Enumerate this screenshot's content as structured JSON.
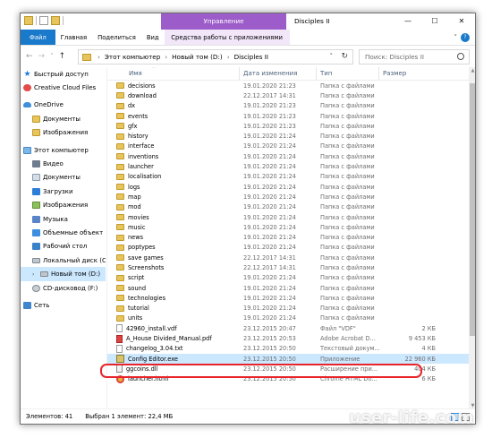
{
  "titlebar": {
    "context_tab": "Управление",
    "title": "Disciples II",
    "minimize": "—",
    "maximize": "☐",
    "close": "✕"
  },
  "ribbon": {
    "tabs": [
      "Файл",
      "Главная",
      "Поделиться",
      "Вид"
    ],
    "context_tab": "Средства работы с приложениями",
    "expand": "˅",
    "help": "?"
  },
  "addressbar": {
    "back": "←",
    "forward": "→",
    "recent": "˅",
    "up": "↑",
    "crumbs": [
      "Этот компьютер",
      "Новый том (D:)",
      "Disciples II"
    ],
    "separator": "›",
    "dropdown": "˅",
    "refresh": "↻",
    "search_placeholder": "Поиск: Disciples II"
  },
  "nav_pane": {
    "items": [
      {
        "label": "Быстрый доступ",
        "icon": "star-icon",
        "level": 0
      },
      {
        "label": "Creative Cloud Files",
        "icon": "creative-cloud-icon",
        "level": 0
      },
      {
        "label": "OneDrive",
        "icon": "onedrive-icon",
        "level": 0
      },
      {
        "label": "Документы",
        "icon": "folder-icon",
        "level": 1
      },
      {
        "label": "Изображения",
        "icon": "folder-icon",
        "level": 1
      },
      {
        "label": "Этот компьютер",
        "icon": "computer-icon",
        "level": 0
      },
      {
        "label": "Видео",
        "icon": "video-icon",
        "level": 1
      },
      {
        "label": "Документы",
        "icon": "documents-icon",
        "level": 1
      },
      {
        "label": "Загрузки",
        "icon": "downloads-icon",
        "level": 1
      },
      {
        "label": "Изображения",
        "icon": "pictures-icon",
        "level": 1
      },
      {
        "label": "Музыка",
        "icon": "music-icon",
        "level": 1
      },
      {
        "label": "Объемные объект",
        "icon": "3d-objects-icon",
        "level": 1
      },
      {
        "label": "Рабочий стол",
        "icon": "desktop-icon",
        "level": 1
      },
      {
        "label": "Локальный диск (C",
        "icon": "drive-icon",
        "level": 1
      },
      {
        "label": "Новый том (D:)",
        "icon": "drive-icon",
        "level": 1,
        "selected": true
      },
      {
        "label": "CD-дисковод (F:)",
        "icon": "cd-drive-icon",
        "level": 1
      },
      {
        "label": "Сеть",
        "icon": "network-icon",
        "level": 0
      }
    ]
  },
  "columns": {
    "name": "Имя",
    "date": "Дата изменения",
    "type": "Тип",
    "size": "Размер",
    "sort_caret": "^"
  },
  "files": [
    {
      "name": "decisions",
      "date": "19.01.2020 21:23",
      "type": "Папка с файлами",
      "size": "",
      "icon": "folder"
    },
    {
      "name": "download",
      "date": "22.12.2017 14:31",
      "type": "Папка с файлами",
      "size": "",
      "icon": "folder"
    },
    {
      "name": "dx",
      "date": "19.01.2020 21:23",
      "type": "Папка с файлами",
      "size": "",
      "icon": "folder"
    },
    {
      "name": "events",
      "date": "19.01.2020 21:23",
      "type": "Папка с файлами",
      "size": "",
      "icon": "folder"
    },
    {
      "name": "gfx",
      "date": "19.01.2020 21:23",
      "type": "Папка с файлами",
      "size": "",
      "icon": "folder"
    },
    {
      "name": "history",
      "date": "19.01.2020 21:24",
      "type": "Папка с файлами",
      "size": "",
      "icon": "folder"
    },
    {
      "name": "interface",
      "date": "19.01.2020 21:24",
      "type": "Папка с файлами",
      "size": "",
      "icon": "folder"
    },
    {
      "name": "inventions",
      "date": "19.01.2020 21:24",
      "type": "Папка с файлами",
      "size": "",
      "icon": "folder"
    },
    {
      "name": "launcher",
      "date": "19.01.2020 21:24",
      "type": "Папка с файлами",
      "size": "",
      "icon": "folder"
    },
    {
      "name": "localisation",
      "date": "19.01.2020 21:24",
      "type": "Папка с файлами",
      "size": "",
      "icon": "folder"
    },
    {
      "name": "logs",
      "date": "19.01.2020 21:24",
      "type": "Папка с файлами",
      "size": "",
      "icon": "folder"
    },
    {
      "name": "map",
      "date": "19.01.2020 21:24",
      "type": "Папка с файлами",
      "size": "",
      "icon": "folder"
    },
    {
      "name": "mod",
      "date": "19.01.2020 21:24",
      "type": "Папка с файлами",
      "size": "",
      "icon": "folder"
    },
    {
      "name": "movies",
      "date": "19.01.2020 21:24",
      "type": "Папка с файлами",
      "size": "",
      "icon": "folder"
    },
    {
      "name": "music",
      "date": "19.01.2020 21:24",
      "type": "Папка с файлами",
      "size": "",
      "icon": "folder"
    },
    {
      "name": "news",
      "date": "19.01.2020 21:24",
      "type": "Папка с файлами",
      "size": "",
      "icon": "folder"
    },
    {
      "name": "poptypes",
      "date": "19.01.2020 21:24",
      "type": "Папка с файлами",
      "size": "",
      "icon": "folder"
    },
    {
      "name": "save games",
      "date": "22.12.2017 14:31",
      "type": "Папка с файлами",
      "size": "",
      "icon": "folder"
    },
    {
      "name": "Screenshots",
      "date": "22.12.2017 14:31",
      "type": "Папка с файлами",
      "size": "",
      "icon": "folder"
    },
    {
      "name": "script",
      "date": "19.01.2020 21:24",
      "type": "Папка с файлами",
      "size": "",
      "icon": "folder"
    },
    {
      "name": "sound",
      "date": "19.01.2020 21:24",
      "type": "Папка с файлами",
      "size": "",
      "icon": "folder"
    },
    {
      "name": "technologies",
      "date": "19.01.2020 21:24",
      "type": "Папка с файлами",
      "size": "",
      "icon": "folder"
    },
    {
      "name": "tutorial",
      "date": "19.01.2020 21:24",
      "type": "Папка с файлами",
      "size": "",
      "icon": "folder"
    },
    {
      "name": "units",
      "date": "19.01.2020 21:24",
      "type": "Папка с файлами",
      "size": "",
      "icon": "folder"
    },
    {
      "name": "42960_install.vdf",
      "date": "23.12.2015 20:47",
      "type": "Файл \"VDF\"",
      "size": "2 КБ",
      "icon": "doc"
    },
    {
      "name": "A_House Divided_Manual.pdf",
      "date": "23.12.2015 20:53",
      "type": "Adobe Acrobat D...",
      "size": "9 453 КБ",
      "icon": "pdf"
    },
    {
      "name": "changelog_3.04.txt",
      "date": "23.12.2015 20:50",
      "type": "Текстовый докум...",
      "size": "4 КБ",
      "icon": "doc"
    },
    {
      "name": "Config Editor.exe",
      "date": "23.12.2015 20:50",
      "type": "Приложение",
      "size": "22 960 КБ",
      "icon": "exe",
      "selected": true
    },
    {
      "name": "ggcoins.dll",
      "date": "23.12.2015 20:50",
      "type": "Расширение при...",
      "size": "404 КБ",
      "icon": "dll"
    },
    {
      "name": "launcher.html",
      "date": "23.12.2015 20:50",
      "type": "Chrome HTML Do...",
      "size": "6 КБ",
      "icon": "chrome"
    }
  ],
  "status": {
    "count": "Элементов: 41",
    "selection": "Выбран 1 элемент: 22,4 МБ"
  },
  "watermark": "user-life.com"
}
